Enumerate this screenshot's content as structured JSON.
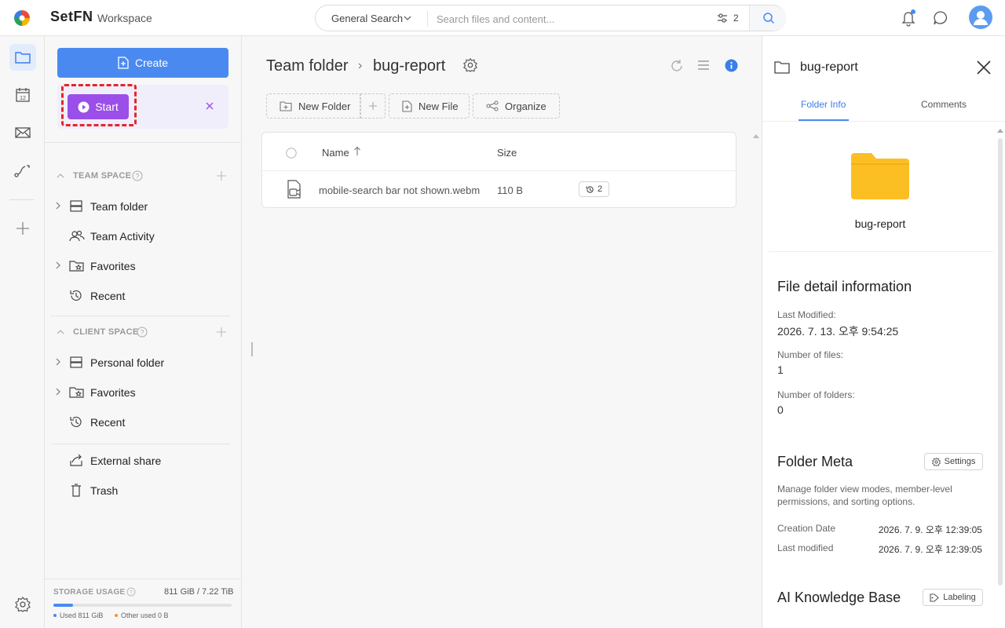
{
  "header": {
    "brand": "SetFN",
    "workspace": "Workspace",
    "search_type": "General Search",
    "search_placeholder": "Search files and content...",
    "filter_count": "2"
  },
  "sidebar": {
    "create_label": "Create",
    "start_label": "Start",
    "team_space_title": "TEAM SPACE",
    "team_items": [
      {
        "label": "Team folder"
      },
      {
        "label": "Team Activity"
      },
      {
        "label": "Favorites"
      },
      {
        "label": "Recent"
      }
    ],
    "client_space_title": "CLIENT SPACE",
    "client_items": [
      {
        "label": "Personal folder"
      },
      {
        "label": "Favorites"
      },
      {
        "label": "Recent"
      }
    ],
    "extra_items": [
      {
        "label": "External share"
      },
      {
        "label": "Trash"
      }
    ],
    "storage": {
      "label": "STORAGE USAGE",
      "value": "811 GiB / 7.22 TiB",
      "used_fraction": 0.11,
      "used_label": "Used 811 GiB",
      "other_label": "Other used 0 B"
    }
  },
  "main": {
    "breadcrumb_root": "Team folder",
    "breadcrumb_sep": "›",
    "breadcrumb_current": "bug-report",
    "toolbar": {
      "new_folder": "New Folder",
      "new_file": "New File",
      "organize": "Organize"
    },
    "table": {
      "col_name": "Name",
      "col_size": "Size",
      "rows": [
        {
          "name": "mobile-search bar not shown.webm",
          "size": "110 B",
          "versions": "2"
        }
      ]
    }
  },
  "panel": {
    "title": "bug-report",
    "tabs": [
      "Folder Info",
      "Comments"
    ],
    "folder_name": "bug-report",
    "detail_title": "File detail information",
    "last_modified_label": "Last Modified:",
    "last_modified_value": "2026. 7. 13. 오후 9:54:25",
    "num_files_label": "Number of files:",
    "num_files_value": "1",
    "num_folders_label": "Number of folders:",
    "num_folders_value": "0",
    "meta_title": "Folder Meta",
    "settings_label": "Settings",
    "meta_desc": "Manage folder view modes, member-level permissions, and sorting options.",
    "creation_label": "Creation Date",
    "creation_value": "2026. 7. 9. 오후 12:39:05",
    "modified_label": "Last modified",
    "modified_value": "2026. 7. 9. 오후 12:39:05",
    "ai_title": "AI Knowledge Base",
    "labeling_label": "Labeling"
  },
  "colors": {
    "accent": "#4a8af0",
    "start_purple": "#9b4ee8",
    "highlight_red": "#e02828",
    "folder_yellow": "#fbbf24"
  }
}
